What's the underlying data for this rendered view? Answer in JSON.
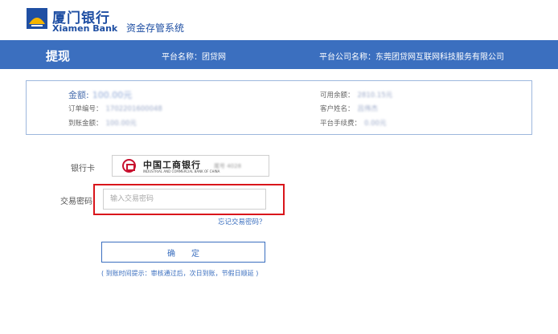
{
  "brand": {
    "name_cn": "厦门银行",
    "name_en": "Xiamen Bank",
    "system_name": "资金存管系统",
    "logo_icon": "xiamen-bank-logo"
  },
  "bar": {
    "title": "提现",
    "platform": "平台名称：团贷网",
    "company": "平台公司名称：东莞团贷网互联网科技服务有限公司",
    "color": "#3b6fbf"
  },
  "info": {
    "amount_label": "金额:",
    "amount_value": "100.00元",
    "order_label": "订单编号：",
    "order_value": "1702201600048",
    "arrival_label": "到账金额：",
    "arrival_value": "100.00元",
    "balance_label": "可用余额：",
    "balance_value": "2810.15元",
    "customer_label": "客户姓名：",
    "customer_value": "吕伟杰",
    "fee_label": "平台手续费：",
    "fee_value": "0.00元"
  },
  "form": {
    "card_label": "银行卡",
    "bank_name_cn": "中国工商银行",
    "bank_name_en": "INDUSTRIAL AND COMMERCIAL BANK OF CHINA",
    "card_tail": "尾号 4028",
    "password_label": "交易密码",
    "password_placeholder": "输入交易密码",
    "forgot_password": "忘记交易密码？",
    "confirm_label": "确定",
    "hint": "( 到账时间提示：审核通过后，次日到账，节假日顺延 )",
    "highlight_color": "#d9151b"
  }
}
